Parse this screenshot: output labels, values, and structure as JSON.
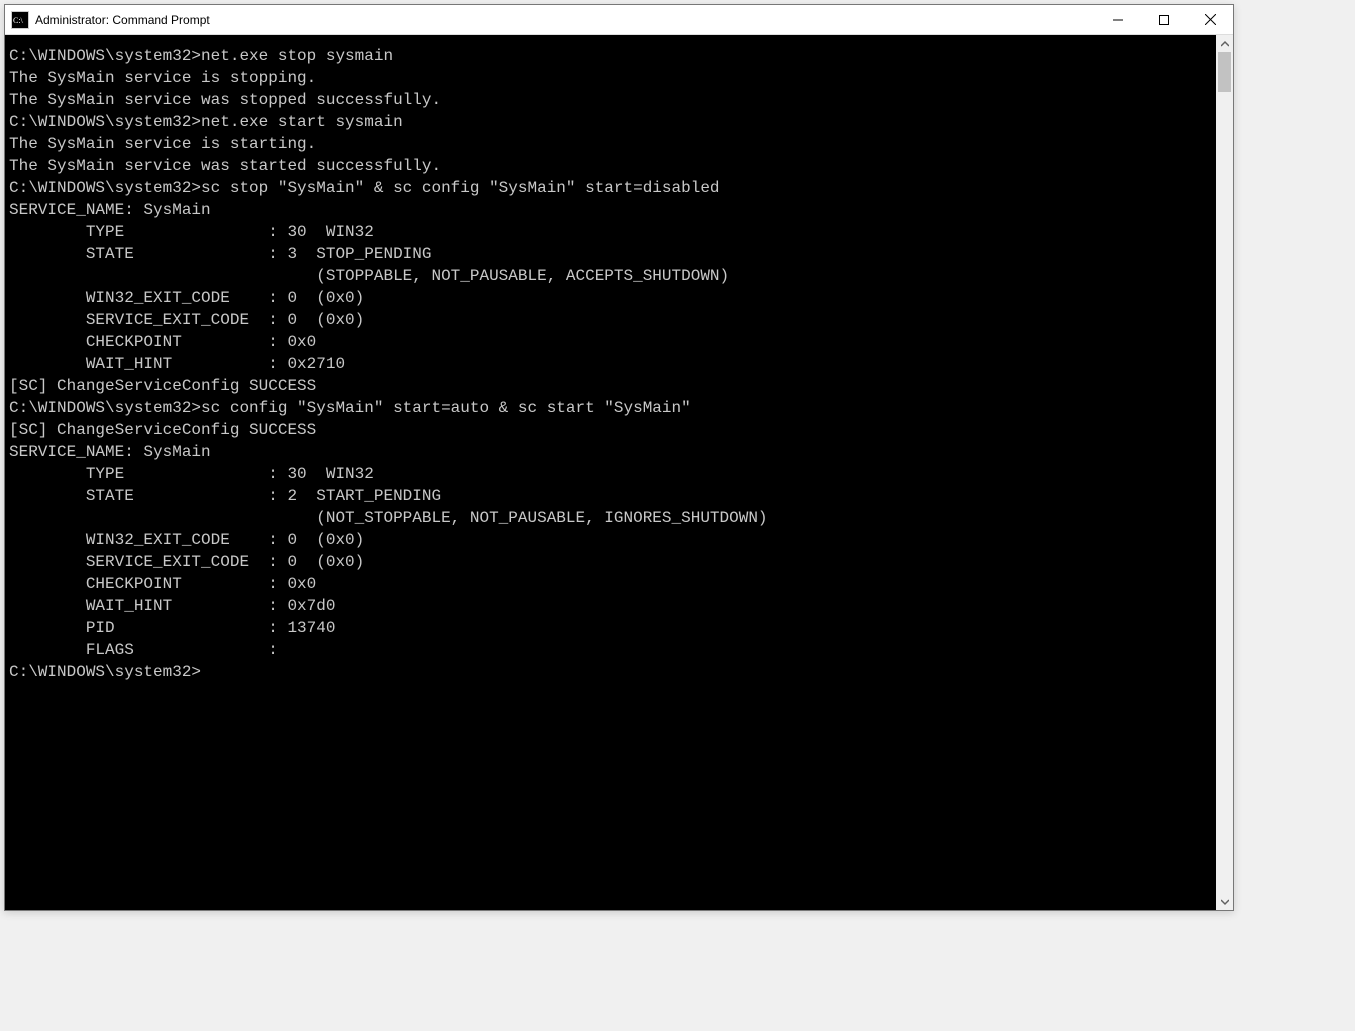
{
  "titlebar": {
    "title": "Administrator: Command Prompt"
  },
  "prompt": "C:\\WINDOWS\\system32>",
  "blocks": [
    {
      "cmd": "net.exe stop sysmain",
      "out": [
        "The SysMain service is stopping.",
        "The SysMain service was stopped successfully.",
        "",
        ""
      ]
    },
    {
      "cmd": "net.exe start sysmain",
      "out": [
        "The SysMain service is starting.",
        "The SysMain service was started successfully.",
        "",
        ""
      ]
    },
    {
      "cmd": "sc stop \"SysMain\" & sc config \"SysMain\" start=disabled",
      "out": [
        "",
        "SERVICE_NAME: SysMain",
        "        TYPE               : 30  WIN32",
        "        STATE              : 3  STOP_PENDING",
        "                                (STOPPABLE, NOT_PAUSABLE, ACCEPTS_SHUTDOWN)",
        "        WIN32_EXIT_CODE    : 0  (0x0)",
        "        SERVICE_EXIT_CODE  : 0  (0x0)",
        "        CHECKPOINT         : 0x0",
        "        WAIT_HINT          : 0x2710",
        "[SC] ChangeServiceConfig SUCCESS",
        ""
      ]
    },
    {
      "cmd": "sc config \"SysMain\" start=auto & sc start \"SysMain\"",
      "out": [
        "[SC] ChangeServiceConfig SUCCESS",
        "",
        "SERVICE_NAME: SysMain",
        "        TYPE               : 30  WIN32",
        "        STATE              : 2  START_PENDING",
        "                                (NOT_STOPPABLE, NOT_PAUSABLE, IGNORES_SHUTDOWN)",
        "        WIN32_EXIT_CODE    : 0  (0x0)",
        "        SERVICE_EXIT_CODE  : 0  (0x0)",
        "        CHECKPOINT         : 0x0",
        "        WAIT_HINT          : 0x7d0",
        "        PID                : 13740",
        "        FLAGS              :",
        ""
      ]
    }
  ]
}
